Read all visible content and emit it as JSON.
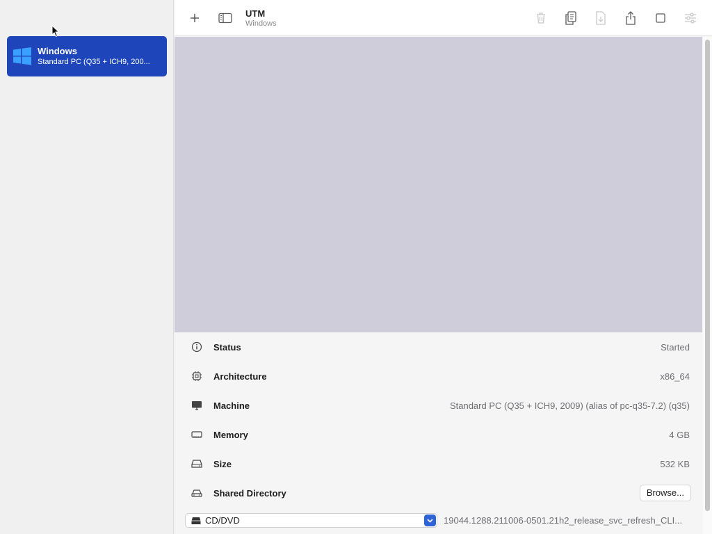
{
  "sidebar": {
    "items": [
      {
        "name": "Windows",
        "subtitle": "Standard PC (Q35 + ICH9, 200...",
        "icon": "windows-logo-icon"
      }
    ]
  },
  "toolbar": {
    "title": "UTM",
    "subtitle": "Windows",
    "buttons": [
      "add-icon",
      "sidebar-toggle-icon",
      "trash-icon",
      "clone-icon",
      "move-icon",
      "share-icon",
      "stop-icon",
      "settings-icon"
    ]
  },
  "details": {
    "rows": [
      {
        "label": "Status",
        "value": "Started",
        "icon": "info-icon"
      },
      {
        "label": "Architecture",
        "value": "x86_64",
        "icon": "cpu-icon"
      },
      {
        "label": "Machine",
        "value": "Standard PC (Q35 + ICH9, 2009) (alias of pc-q35-7.2) (q35)",
        "icon": "display-icon"
      },
      {
        "label": "Memory",
        "value": "4 GB",
        "icon": "memory-icon"
      },
      {
        "label": "Size",
        "value": "532 KB",
        "icon": "disk-icon"
      },
      {
        "label": "Shared Directory",
        "button": "Browse...",
        "icon": "car-drive-icon"
      }
    ],
    "cd": {
      "selected": "CD/DVD",
      "path": "19044.1288.211006-0501.21h2_release_svc_refresh_CLI..."
    }
  },
  "colors": {
    "selection": "#1e46ba",
    "preview": "#cfcdd9",
    "accent": "#2f63d6"
  }
}
